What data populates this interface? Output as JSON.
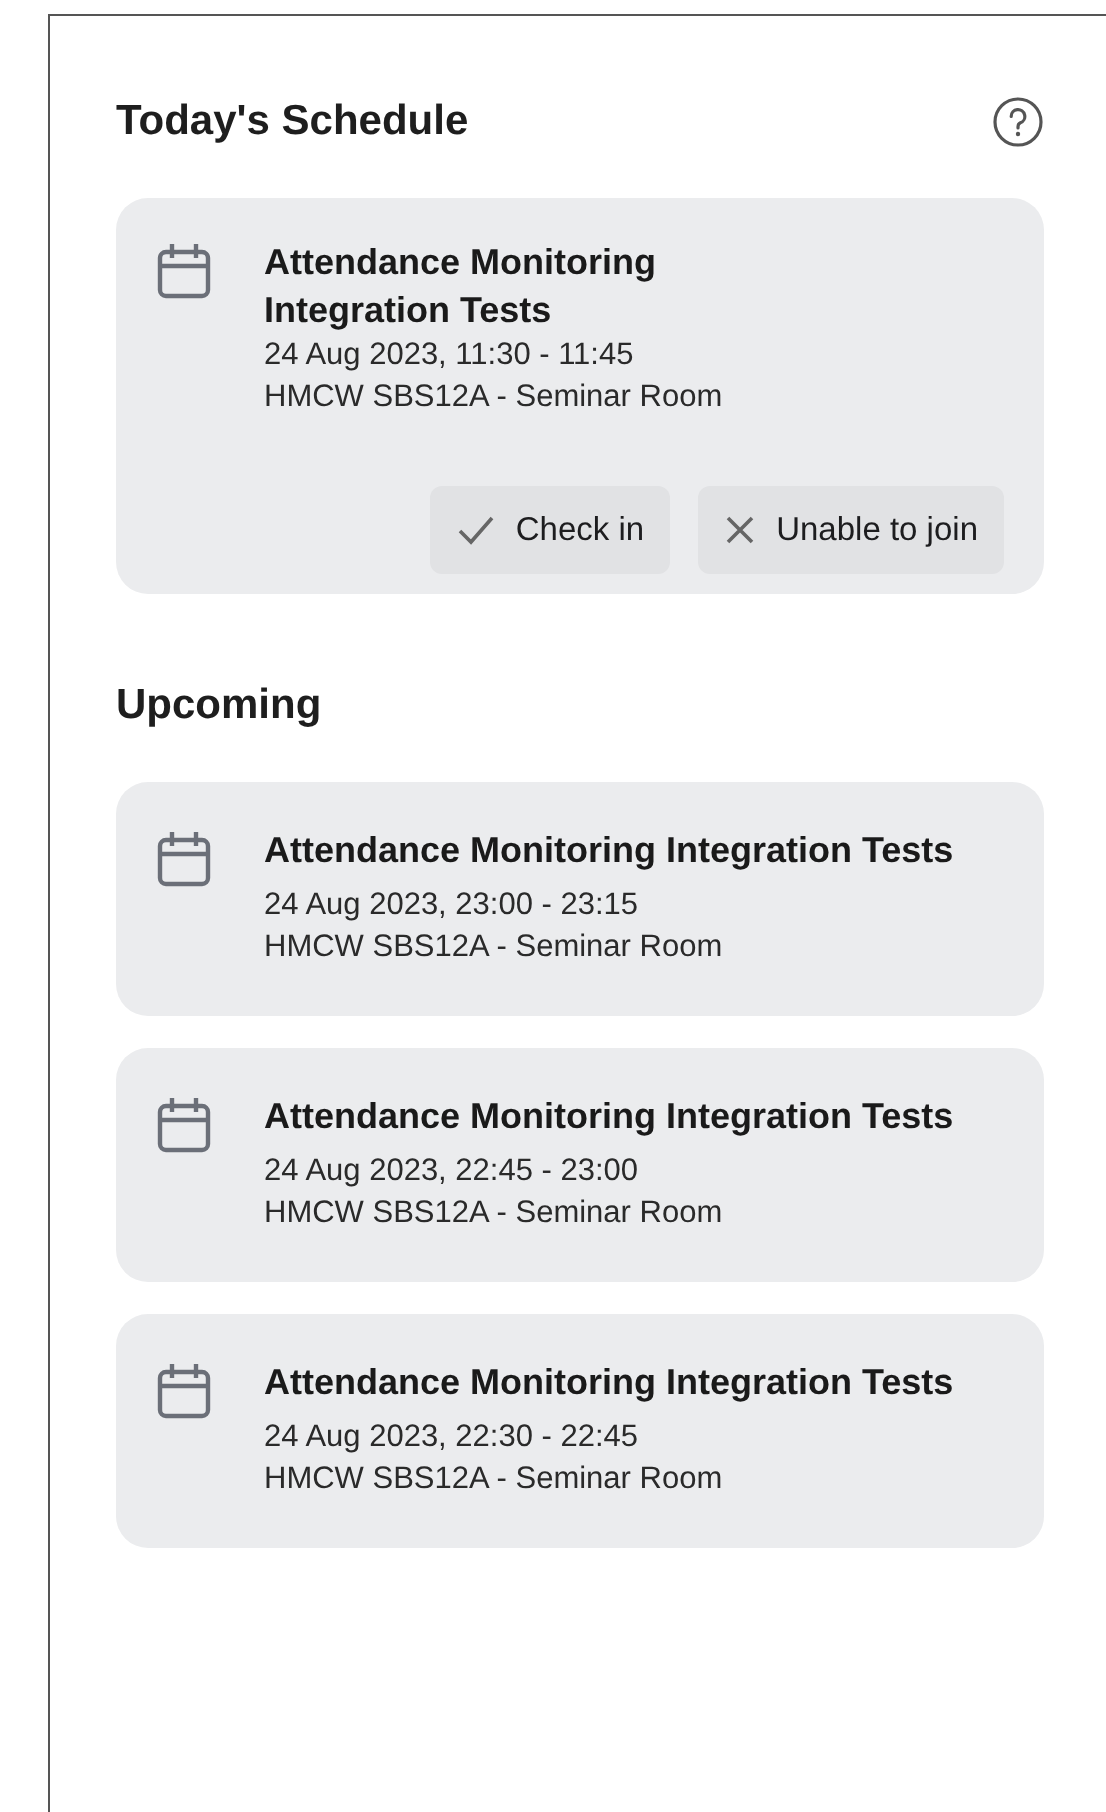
{
  "today": {
    "title": "Today's Schedule",
    "event": {
      "title": "Attendance Monitoring Integration Tests",
      "time": "24 Aug 2023, 11:30 - 11:45",
      "location": "HMCW SBS12A - Seminar Room"
    },
    "actions": [
      {
        "kind": "check",
        "label": "Check in"
      },
      {
        "kind": "cross",
        "label": "Unable to join"
      }
    ]
  },
  "upcoming": {
    "title": "Upcoming",
    "events": [
      {
        "title": "Attendance Monitoring Integration Tests",
        "time": "24 Aug 2023, 23:00 - 23:15",
        "location": "HMCW SBS12A - Seminar Room"
      },
      {
        "title": "Attendance Monitoring Integration Tests",
        "time": "24 Aug 2023, 22:45 - 23:00",
        "location": "HMCW SBS12A - Seminar Room"
      },
      {
        "title": "Attendance Monitoring Integration Tests",
        "time": "24 Aug 2023, 22:30 - 22:45",
        "location": "HMCW SBS12A - Seminar Room"
      }
    ]
  }
}
